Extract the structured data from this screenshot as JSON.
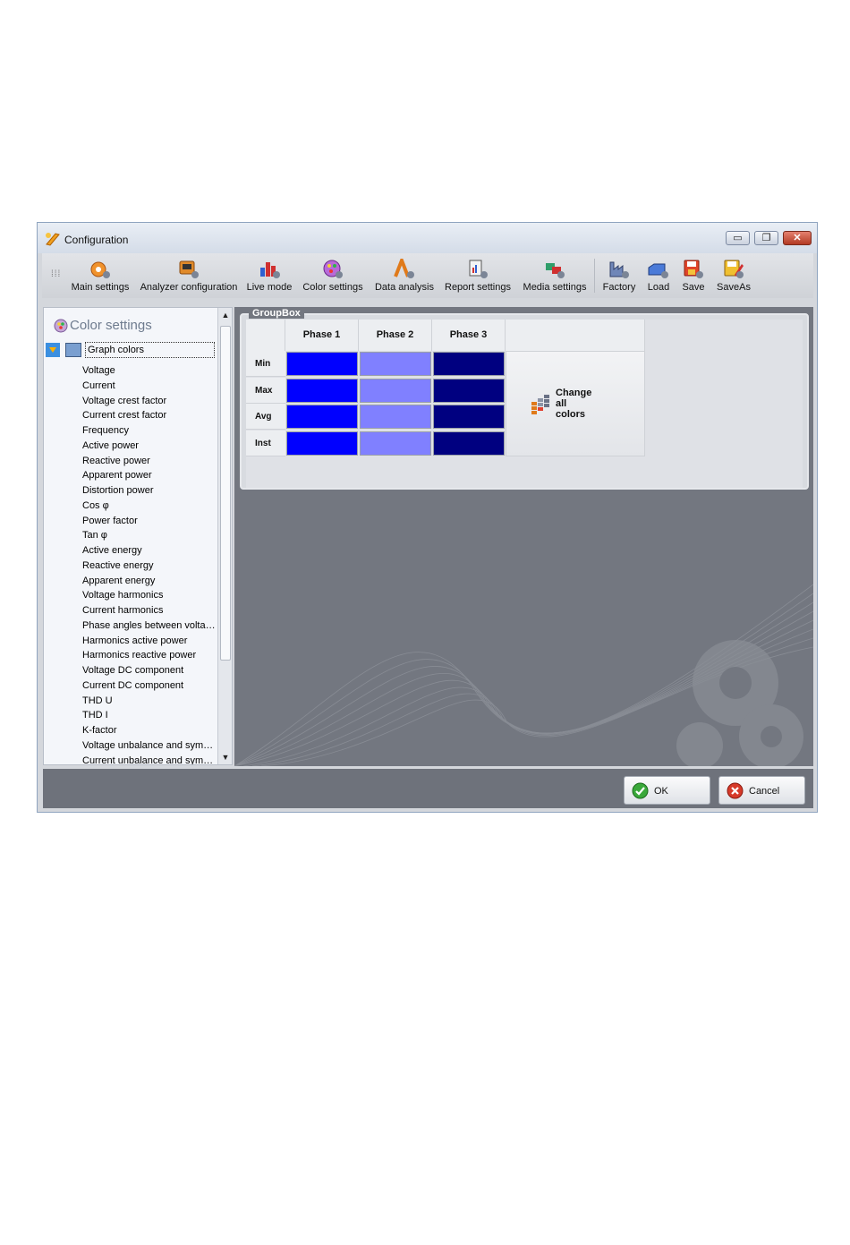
{
  "window": {
    "title": "Configuration"
  },
  "toolbar": {
    "items": [
      {
        "label": "Main settings",
        "icon": "gear-icon"
      },
      {
        "label": "Analyzer configuration",
        "icon": "analyzer-icon"
      },
      {
        "label": "Live mode",
        "icon": "live-chart-icon"
      },
      {
        "label": "Color settings",
        "icon": "color-palette-icon"
      },
      {
        "label": "Data analysis",
        "icon": "data-analysis-icon"
      },
      {
        "label": "Report settings",
        "icon": "report-icon"
      },
      {
        "label": "Media settings",
        "icon": "media-icon"
      },
      {
        "label": "Factory",
        "icon": "factory-icon"
      },
      {
        "label": "Load",
        "icon": "load-icon"
      },
      {
        "label": "Save",
        "icon": "save-icon"
      },
      {
        "label": "SaveAs",
        "icon": "save-as-icon"
      }
    ]
  },
  "sidebar": {
    "title": "Color settings",
    "root": "Graph colors",
    "items": [
      "Voltage",
      "Current",
      "Voltage crest factor",
      "Current crest factor",
      "Frequency",
      "Active power",
      "Reactive power",
      "Apparent power",
      "Distortion power",
      "Cos φ",
      "Power factor",
      "Tan φ",
      "Active energy",
      "Reactive energy",
      "Apparent energy",
      "Voltage harmonics",
      "Current harmonics",
      "Phase angles between voltages",
      "Harmonics active power",
      "Harmonics reactive power",
      "Voltage DC component",
      "Current DC component",
      "THD U",
      "THD I",
      "K-factor",
      "Voltage unbalance and symmetrical components",
      "Current unbalance and symmetrical components"
    ]
  },
  "groupbox": {
    "title": "GroupBox",
    "columns": [
      "Phase 1",
      "Phase 2",
      "Phase 3"
    ],
    "rows": [
      "Min",
      "Max",
      "Avg",
      "Inst"
    ],
    "phase_colors": [
      "#0000ff",
      "#8080ff",
      "#000080"
    ],
    "change_all": {
      "line1": "Change",
      "line2": "all",
      "line3": "colors"
    }
  },
  "buttons": {
    "ok": "OK",
    "cancel": "Cancel"
  }
}
